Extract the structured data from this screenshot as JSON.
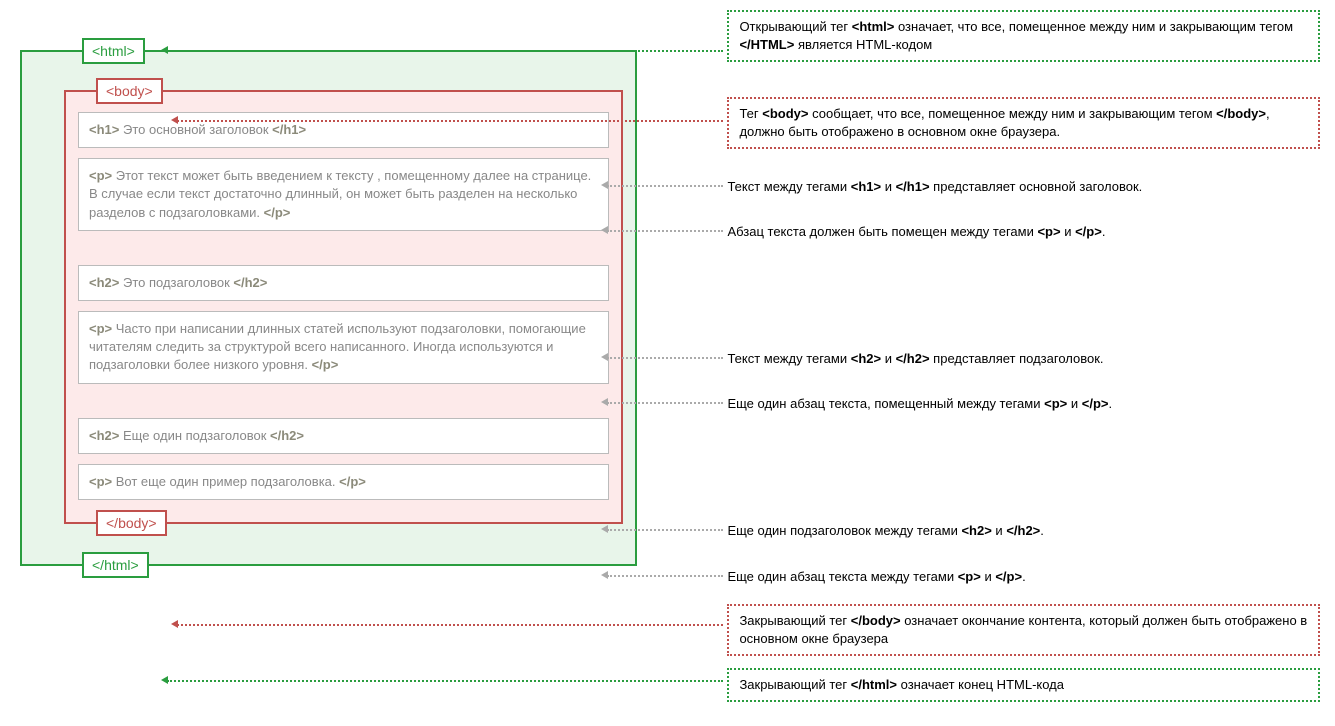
{
  "tags": {
    "html_open": "<html>",
    "html_close": "</html>",
    "body_open": "<body>",
    "body_close": "</body>"
  },
  "elements": [
    {
      "open": "<h1>",
      "text": " Это  основной  заголовок ",
      "close": "</h1>"
    },
    {
      "open": "<p>",
      "text": " Этот  текст  может  быть   введением к  тексту , помещенному далее  на  странице.  В  случае  если текст достаточно длинный, он может быть разделен на несколько разделов с  подзаголовками. ",
      "close": "</p>"
    },
    {
      "open": "<h2>",
      "text": " Это  подзаголовок ",
      "close": "</h2>"
    },
    {
      "open": "<p>",
      "text": " Часто при  написании  длинных  статей  используют подзаголовки,  помогающие   читателям  следить  за структурой всего  написанного.   Иногда  используются и подзаголовки более  низкого  уровня. ",
      "close": "</p>"
    },
    {
      "open": "<h2>",
      "text": " Еще  один  подзаголовок ",
      "close": "</h2>"
    },
    {
      "open": "<p>",
      "text": " Вот еще  один  пример  подзаголовка. ",
      "close": "</p>"
    }
  ],
  "annotations": {
    "html_open": {
      "pre": "Открывающий тег ",
      "b1": "<html>",
      "mid": " означает, что все, помещенное между ним и закрывающим тегом ",
      "b2": "</HTML>",
      "post": " является HTML-кодом"
    },
    "body_open": {
      "pre": "Тег ",
      "b1": "<body>",
      "mid": " сообщает, что все, помещенное между ним и закрывающим тегом ",
      "b2": "</body>",
      "post": ", должно быть отображено в основном окне браузера."
    },
    "h1": {
      "pre": "Текст между тегами ",
      "b1": "<h1>",
      "mid": " и ",
      "b2": "</h1>",
      "post": " представляет основной заголовок."
    },
    "p1": {
      "pre": "Абзац текста должен быть помещен между тегами ",
      "b1": "<p>",
      "mid": " и ",
      "b2": "</p>",
      "post": "."
    },
    "h2": {
      "pre": "Текст между тегами ",
      "b1": "<h2>",
      "mid": " и ",
      "b2": "</h2>",
      "post": " представляет подзаголовок."
    },
    "p2": {
      "pre": "Еще один абзац текста, помещенный между тегами ",
      "b1": "<p>",
      "mid": " и ",
      "b2": "</p>",
      "post": "."
    },
    "h2b": {
      "pre": "Еще один подзаголовок между тегами ",
      "b1": "<h2>",
      "mid": " и ",
      "b2": "</h2>",
      "post": "."
    },
    "p3": {
      "pre": "Еще один абзац текста между тегами ",
      "b1": "<p>",
      "mid": " и ",
      "b2": "</p>",
      "post": "."
    },
    "body_close": {
      "pre": "Закрывающий тег ",
      "b1": "</body>",
      "mid": " означает окончание контента, который должен быть отображено в основном окне браузера",
      "b2": "",
      "post": ""
    },
    "html_close": {
      "pre": "Закрывающий тег ",
      "b1": "</html>",
      "mid": " означает конец HTML-кода",
      "b2": "",
      "post": ""
    }
  }
}
